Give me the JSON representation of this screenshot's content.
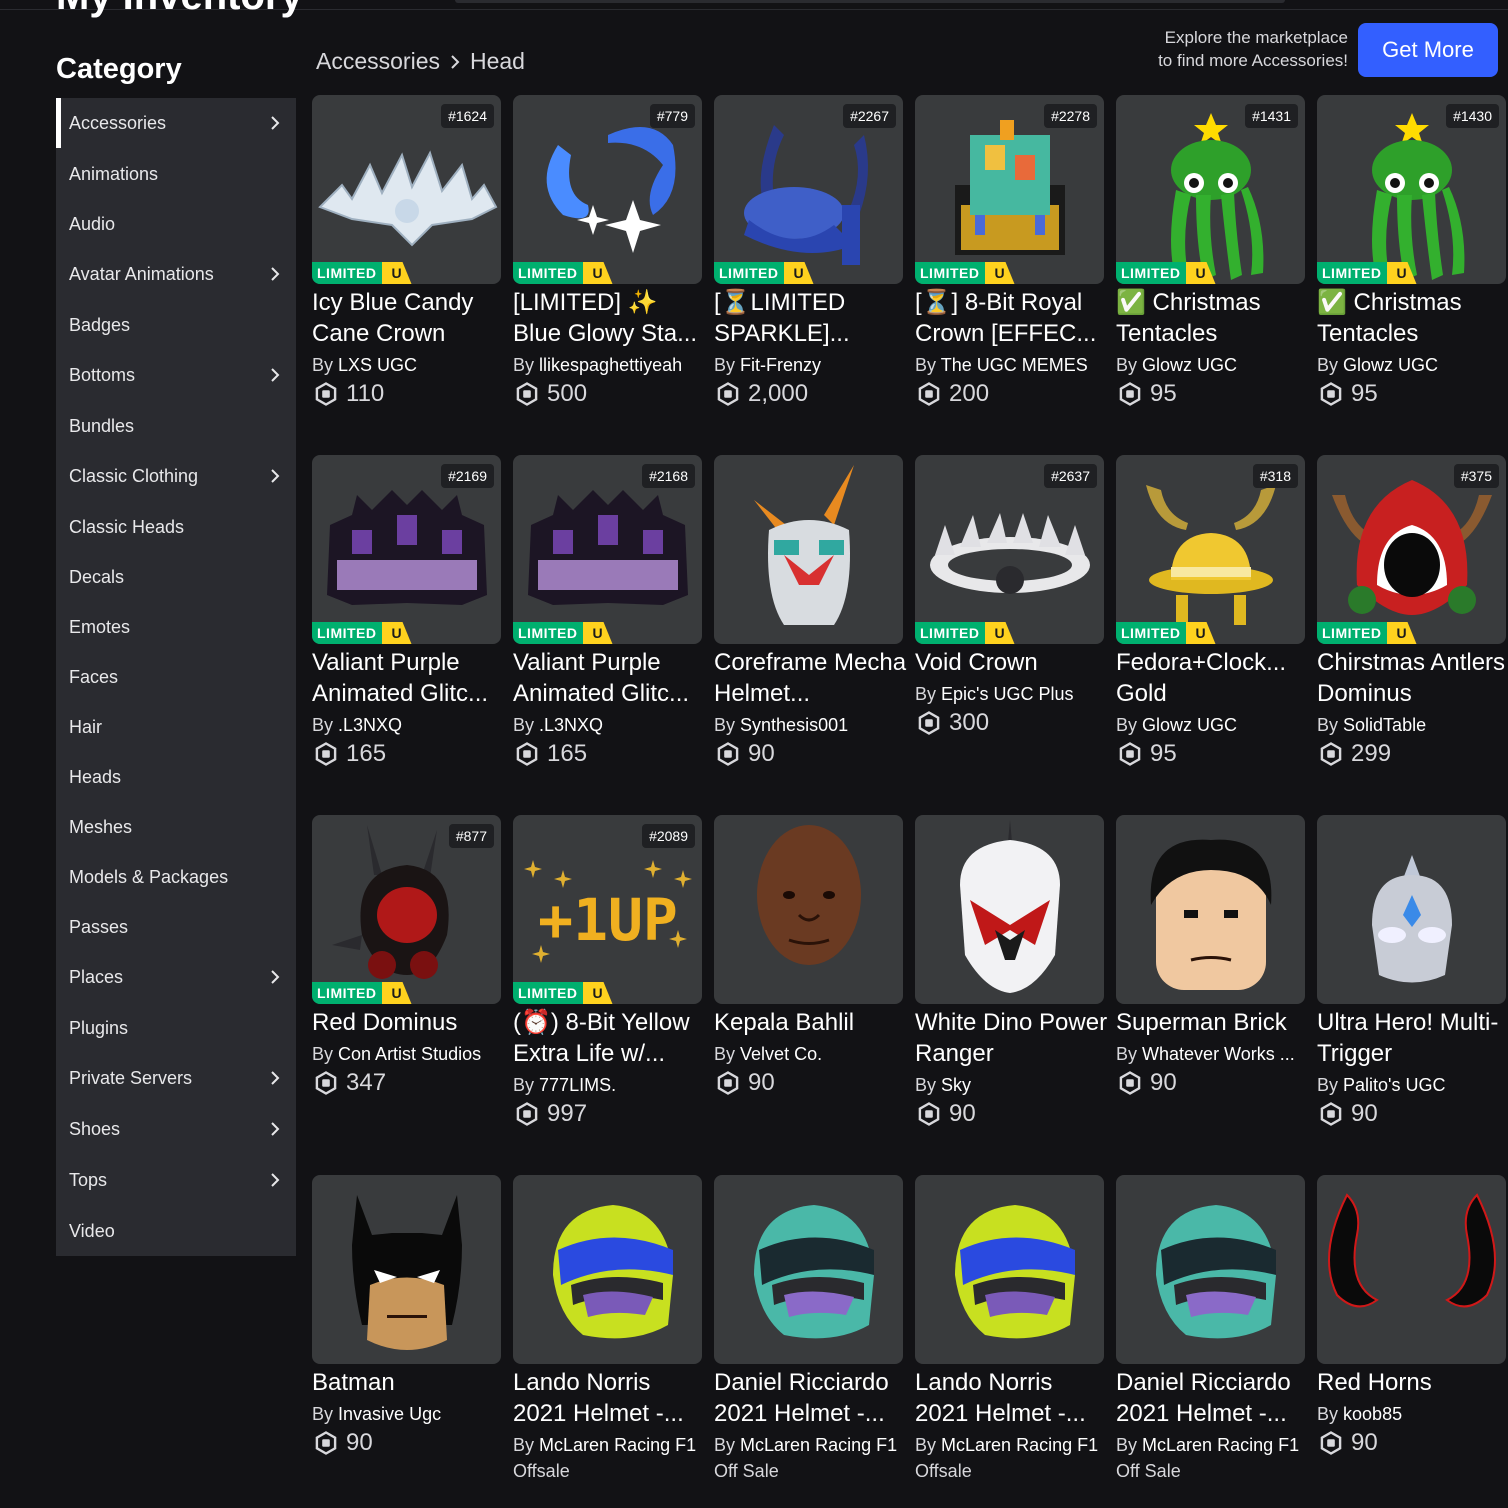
{
  "page_title": "My Inventory",
  "sidebar": {
    "heading": "Category",
    "items": [
      {
        "label": "Accessories",
        "has_submenu": true,
        "active": true
      },
      {
        "label": "Animations",
        "has_submenu": false
      },
      {
        "label": "Audio",
        "has_submenu": false
      },
      {
        "label": "Avatar Animations",
        "has_submenu": true
      },
      {
        "label": "Badges",
        "has_submenu": false
      },
      {
        "label": "Bottoms",
        "has_submenu": true
      },
      {
        "label": "Bundles",
        "has_submenu": false
      },
      {
        "label": "Classic Clothing",
        "has_submenu": true
      },
      {
        "label": "Classic Heads",
        "has_submenu": false
      },
      {
        "label": "Decals",
        "has_submenu": false
      },
      {
        "label": "Emotes",
        "has_submenu": false
      },
      {
        "label": "Faces",
        "has_submenu": false
      },
      {
        "label": "Hair",
        "has_submenu": false
      },
      {
        "label": "Heads",
        "has_submenu": false
      },
      {
        "label": "Meshes",
        "has_submenu": false
      },
      {
        "label": "Models & Packages",
        "has_submenu": false
      },
      {
        "label": "Passes",
        "has_submenu": false
      },
      {
        "label": "Places",
        "has_submenu": true
      },
      {
        "label": "Plugins",
        "has_submenu": false
      },
      {
        "label": "Private Servers",
        "has_submenu": true
      },
      {
        "label": "Shoes",
        "has_submenu": true
      },
      {
        "label": "Tops",
        "has_submenu": true
      },
      {
        "label": "Video",
        "has_submenu": false
      }
    ]
  },
  "breadcrumb": {
    "parent": "Accessories",
    "current": "Head"
  },
  "explore": {
    "line1": "Explore the marketplace",
    "line2": "to find more Accessories!",
    "button": "Get More"
  },
  "colors": {
    "accent": "#335fff",
    "limited_green": "#00b06f",
    "limited_yellow": "#ffd21e",
    "sidebar_bg": "#2a2b30",
    "card_bg": "#393b3d",
    "page_bg": "#121215"
  },
  "by_label": "By",
  "limited_label": "LIMITED",
  "unique_label": "U",
  "items": [
    {
      "serial": "#1624",
      "limited": true,
      "name": "Icy Blue Candy Cane Crown",
      "creator": "LXS UGC",
      "price": "110",
      "icon": "icy-crown"
    },
    {
      "serial": "#779",
      "limited": true,
      "name": "[LIMITED] ✨ Blue Glowy Sta...",
      "creator": "llikespaghettiyeah",
      "price": "500",
      "icon": "blue-stars"
    },
    {
      "serial": "#2267",
      "limited": true,
      "name": "[⏳LIMITED SPARKLE]...",
      "creator": "Fit-Frenzy",
      "price": "2,000",
      "icon": "blue-hat"
    },
    {
      "serial": "#2278",
      "limited": true,
      "name": "[⏳] 8-Bit Royal Crown [EFFEC...",
      "creator": "The UGC MEMES",
      "price": "200",
      "icon": "pixel-crown"
    },
    {
      "serial": "#1431",
      "limited": true,
      "name": "✅ Christmas Tentacles",
      "creator": "Glowz UGC",
      "price": "95",
      "icon": "tentacles"
    },
    {
      "serial": "#1430",
      "limited": true,
      "name": "✅ Christmas Tentacles",
      "creator": "Glowz UGC",
      "price": "95",
      "icon": "tentacles"
    },
    {
      "serial": "#2169",
      "limited": true,
      "name": "Valiant Purple Animated Glitc...",
      "creator": ".L3NXQ",
      "price": "165",
      "icon": "purple-crown"
    },
    {
      "serial": "#2168",
      "limited": true,
      "name": "Valiant Purple Animated Glitc...",
      "creator": ".L3NXQ",
      "price": "165",
      "icon": "purple-crown"
    },
    {
      "serial": "",
      "limited": false,
      "name": "Coreframe Mecha Helmet...",
      "creator": "Synthesis001",
      "price": "90",
      "icon": "mecha-helmet"
    },
    {
      "serial": "#2637",
      "limited": true,
      "name": "Void Crown",
      "creator": "Epic's UGC Plus",
      "price": "300",
      "icon": "void-crown"
    },
    {
      "serial": "#318",
      "limited": true,
      "name": "Fedora+Clock... Gold",
      "creator": "Glowz UGC",
      "price": "95",
      "icon": "gold-fedora"
    },
    {
      "serial": "#375",
      "limited": true,
      "name": "Chirstmas Antlers Dominus",
      "creator": "SolidTable",
      "price": "299",
      "icon": "antler-dominus"
    },
    {
      "serial": "#877",
      "limited": true,
      "name": "Red Dominus",
      "creator": "Con Artist Studios",
      "price": "347",
      "icon": "red-dominus"
    },
    {
      "serial": "#2089",
      "limited": true,
      "name": "(⏰) 8-Bit Yellow Extra Life w/...",
      "creator": "777LIMS.",
      "price": "997",
      "icon": "one-up"
    },
    {
      "serial": "",
      "limited": false,
      "name": "Kepala Bahlil",
      "creator": "Velvet Co.",
      "price": "90",
      "icon": "head"
    },
    {
      "serial": "",
      "limited": false,
      "name": "White Dino Power Ranger",
      "creator": "Sky",
      "price": "90",
      "icon": "ranger-helmet"
    },
    {
      "serial": "",
      "limited": false,
      "name": "Superman Brick",
      "creator": "Whatever Works ...",
      "price": "90",
      "icon": "superman-head"
    },
    {
      "serial": "",
      "limited": false,
      "name": "Ultra Hero! Multi-Trigger",
      "creator": "Palito's UGC",
      "price": "90",
      "icon": "ultra-helmet"
    },
    {
      "serial": "",
      "limited": false,
      "name": "Batman",
      "creator": "Invasive Ugc",
      "price": "90",
      "icon": "batman-mask"
    },
    {
      "serial": "",
      "limited": false,
      "name": "Lando Norris 2021 Helmet -...",
      "creator": "McLaren Racing F1",
      "offsale": "Offsale",
      "icon": "yellow-helmet"
    },
    {
      "serial": "",
      "limited": false,
      "name": "Daniel Ricciardo 2021 Helmet -...",
      "creator": "McLaren Racing F1",
      "offsale": "Off Sale",
      "icon": "teal-helmet"
    },
    {
      "serial": "",
      "limited": false,
      "name": "Lando Norris 2021 Helmet -...",
      "creator": "McLaren Racing F1",
      "offsale": "Offsale",
      "icon": "yellow-helmet"
    },
    {
      "serial": "",
      "limited": false,
      "name": "Daniel Ricciardo 2021 Helmet -...",
      "creator": "McLaren Racing F1",
      "offsale": "Off Sale",
      "icon": "teal-helmet"
    },
    {
      "serial": "",
      "limited": false,
      "name": "Red Horns",
      "creator": "koob85",
      "price": "90",
      "icon": "red-horns"
    }
  ]
}
